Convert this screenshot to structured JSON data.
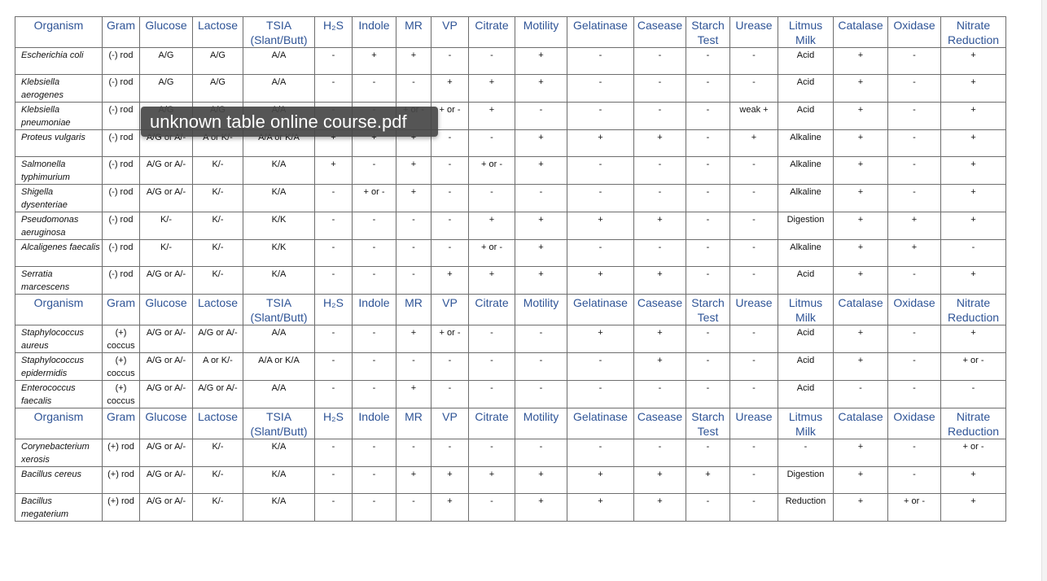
{
  "headers": [
    "Organism",
    "Gram",
    "Glucose",
    "Lactose",
    "TSIA (Slant/Butt)",
    "H₂S",
    "Indole",
    "MR",
    "VP",
    "Citrate",
    "Motility",
    "Gelatinase",
    "Casease",
    "Starch Test",
    "Urease",
    "Litmus Milk",
    "Catalase",
    "Oxidase",
    "Nitrate Reduction"
  ],
  "sections": [
    {
      "rows": [
        [
          "Escherichia coli",
          "(-) rod",
          "A/G",
          "A/G",
          "A/A",
          "-",
          "+",
          "+",
          "-",
          "-",
          "+",
          "-",
          "-",
          "-",
          "-",
          "Acid",
          "+",
          "-",
          "+"
        ],
        [
          "Klebsiella aerogenes",
          "(-) rod",
          "A/G",
          "A/G",
          "A/A",
          "-",
          "-",
          "-",
          "+",
          "+",
          "+",
          "-",
          "-",
          "-",
          "-",
          "Acid",
          "+",
          "-",
          "+"
        ],
        [
          "Klebsiella pneumoniae",
          "(-) rod",
          "A/G",
          "A/G",
          "A/A",
          "-",
          "-",
          "+ or -",
          "+ or -",
          "+",
          "-",
          "-",
          "-",
          "-",
          "weak +",
          "Acid",
          "+",
          "-",
          "+"
        ],
        [
          "Proteus vulgaris",
          "(-) rod",
          "A/G or A/-",
          "A or K/-",
          "A/A or K/A",
          "+",
          "+",
          "+",
          "-",
          "-",
          "+",
          "+",
          "+",
          "-",
          "+",
          "Alkaline",
          "+",
          "-",
          "+"
        ],
        [
          "Salmonella typhimurium",
          "(-) rod",
          "A/G or A/-",
          "K/-",
          "K/A",
          "+",
          "-",
          "+",
          "-",
          "+ or -",
          "+",
          "-",
          "-",
          "-",
          "-",
          "Alkaline",
          "+",
          "-",
          "+"
        ],
        [
          "Shigella dysenteriae",
          "(-) rod",
          "A/G or A/-",
          "K/-",
          "K/A",
          "-",
          "+ or -",
          "+",
          "-",
          "-",
          "-",
          "-",
          "-",
          "-",
          "-",
          "Alkaline",
          "+",
          "-",
          "+"
        ],
        [
          "Pseudomonas aeruginosa",
          "(-) rod",
          "K/-",
          "K/-",
          "K/K",
          "-",
          "-",
          "-",
          "-",
          "+",
          "+",
          "+",
          "+",
          "-",
          "-",
          "Digestion",
          "+",
          "+",
          "+"
        ],
        [
          "Alcaligenes faecalis",
          "(-) rod",
          "K/-",
          "K/-",
          "K/K",
          "-",
          "-",
          "-",
          "-",
          "+ or -",
          "+",
          "-",
          "-",
          "-",
          "-",
          "Alkaline",
          "+",
          "+",
          "-"
        ],
        [
          "Serratia marcescens",
          "(-) rod",
          "A/G or A/-",
          "K/-",
          "K/A",
          "-",
          "-",
          "-",
          "+",
          "+",
          "+",
          "+",
          "+",
          "-",
          "-",
          "Acid",
          "+",
          "-",
          "+"
        ]
      ]
    },
    {
      "rows": [
        [
          "Staphylococcus aureus",
          "(+) coccus",
          "A/G or A/-",
          "A/G or A/-",
          "A/A",
          "-",
          "-",
          "+",
          "+ or -",
          "-",
          "-",
          "+",
          "+",
          "-",
          "-",
          "Acid",
          "+",
          "-",
          "+"
        ],
        [
          "Staphylococcus epidermidis",
          "(+) coccus",
          "A/G or A/-",
          "A or K/-",
          "A/A or K/A",
          "-",
          "-",
          "-",
          "-",
          "-",
          "-",
          "-",
          "+",
          "-",
          "-",
          "Acid",
          "+",
          "-",
          "+ or -"
        ],
        [
          "Enterococcus faecalis",
          "(+) coccus",
          "A/G or A/-",
          "A/G or A/-",
          "A/A",
          "-",
          "-",
          "+",
          "-",
          "-",
          "-",
          "-",
          "-",
          "-",
          "-",
          "Acid",
          "-",
          "-",
          "-"
        ]
      ]
    },
    {
      "rows": [
        [
          "Corynebacterium xerosis",
          "(+) rod",
          "A/G or A/-",
          "K/-",
          "K/A",
          "-",
          "-",
          "-",
          "-",
          "-",
          "-",
          "-",
          "-",
          "-",
          "-",
          "-",
          "+",
          "-",
          "+ or -"
        ],
        [
          "Bacillus cereus",
          "(+) rod",
          "A/G or A/-",
          "K/-",
          "K/A",
          "-",
          "-",
          "+",
          "+",
          "+",
          "+",
          "+",
          "+",
          "+",
          "-",
          "Digestion",
          "+",
          "-",
          "+"
        ],
        [
          "Bacillus megaterium",
          "(+) rod",
          "A/G or A/-",
          "K/-",
          "K/A",
          "-",
          "-",
          "-",
          "+",
          "-",
          "+",
          "+",
          "+",
          "-",
          "-",
          "Reduction",
          "+",
          "+ or -",
          "+"
        ]
      ]
    }
  ],
  "tooltip": "unknown table online course.pdf"
}
